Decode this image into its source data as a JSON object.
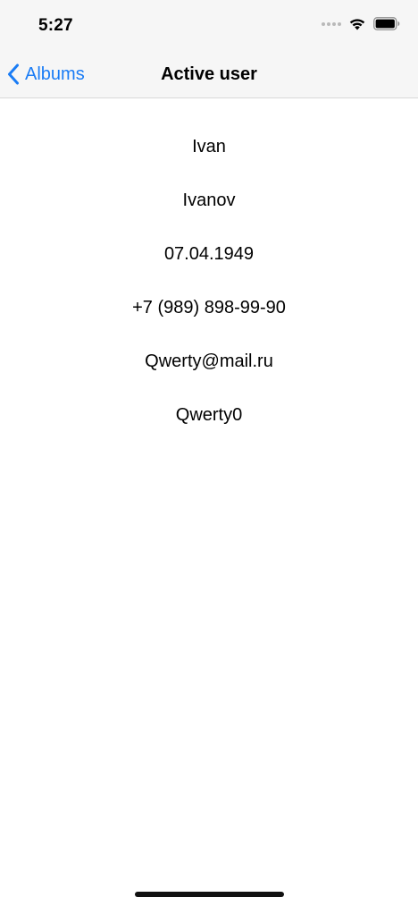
{
  "status_bar": {
    "time": "5:27",
    "icons": [
      "signal-dots-icon",
      "wifi-icon",
      "battery-icon"
    ]
  },
  "nav": {
    "back_label": "Albums",
    "title": "Active user"
  },
  "user": {
    "first_name": "Ivan",
    "last_name": "Ivanov",
    "birth_date": "07.04.1949",
    "phone": "+7 (989) 898-99-90",
    "email": "Qwerty@mail.ru",
    "password": "Qwerty0"
  },
  "colors": {
    "accent": "#1a7cf5",
    "bar_background": "#f6f6f6",
    "text": "#000000"
  }
}
